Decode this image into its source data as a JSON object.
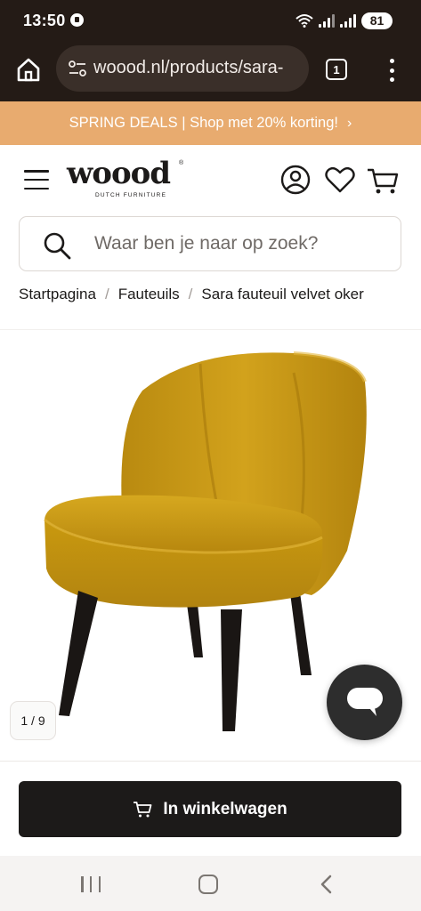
{
  "status_bar": {
    "time": "13:50",
    "battery": "81"
  },
  "browser": {
    "url": "woood.nl/products/sara-",
    "tab_count": "1"
  },
  "promo": {
    "text": "SPRING DEALS | Shop met 20% korting!"
  },
  "header": {
    "logo_text": "woood",
    "logo_sub": "DUTCH FURNITURE",
    "logo_reg": "®"
  },
  "search": {
    "placeholder": "Waar ben je naar op zoek?"
  },
  "breadcrumb": {
    "items": [
      "Startpagina",
      "Fauteuils",
      "Sara fauteuil velvet oker"
    ],
    "separator": "/"
  },
  "gallery": {
    "counter": "1 / 9"
  },
  "cart": {
    "button_label": "In winkelwagen"
  },
  "colors": {
    "chrome": "#241b16",
    "promo": "#e8ab6f",
    "button": "#1c1a19",
    "chair": "#c99a16"
  }
}
